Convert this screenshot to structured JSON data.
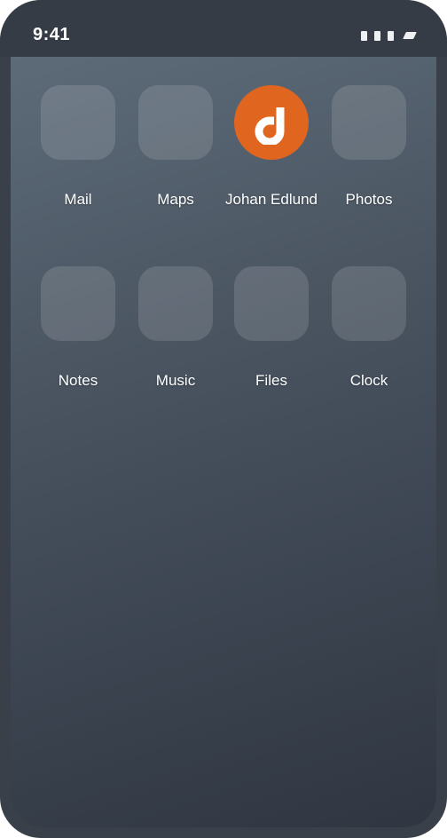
{
  "status_bar": {
    "time": "9:41",
    "signal_icon": "signal-bars-icon",
    "battery_icon": "battery-icon"
  },
  "home_screen": {
    "apps": [
      {
        "label": "Mail",
        "icon": "mail-icon"
      },
      {
        "label": "Maps",
        "icon": "maps-icon"
      },
      {
        "label": "Johan Edlund",
        "icon": "johan-edlund-logo-icon"
      },
      {
        "label": "Photos",
        "icon": "photos-icon"
      },
      {
        "label": "Notes",
        "icon": "notes-icon"
      },
      {
        "label": "Music",
        "icon": "music-icon"
      },
      {
        "label": "Files",
        "icon": "files-icon"
      },
      {
        "label": "Clock",
        "icon": "clock-icon"
      }
    ]
  },
  "colors": {
    "logo_orange": "#e0651f",
    "screen_top": "#5d6b79",
    "screen_bottom": "#303641",
    "frame": "#3a4049"
  }
}
